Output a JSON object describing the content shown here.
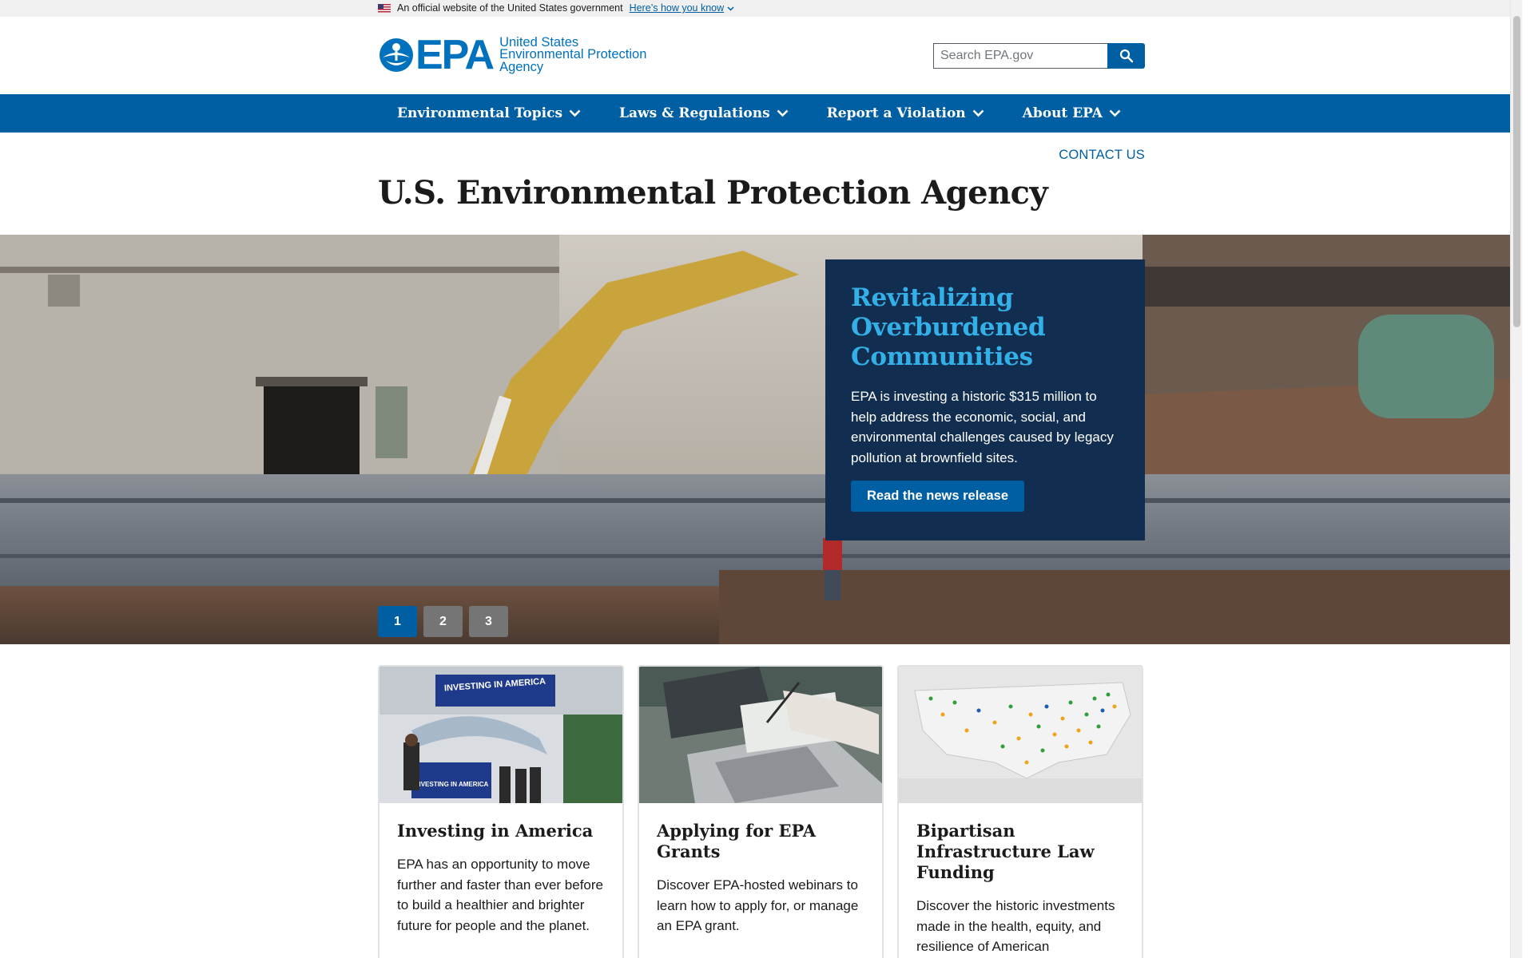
{
  "gov_banner": {
    "text": "An official website of the United States government",
    "link": "Here’s how you know"
  },
  "header": {
    "logo_text": "EPA",
    "agency_line1": "United States",
    "agency_line2": "Environmental Protection",
    "agency_line3": "Agency",
    "search_placeholder": "Search EPA.gov"
  },
  "nav": {
    "items": [
      {
        "label": "Environmental Topics"
      },
      {
        "label": "Laws & Regulations"
      },
      {
        "label": "Report a Violation"
      },
      {
        "label": "About EPA"
      }
    ]
  },
  "contact_label": "CONTACT US",
  "page_title": "U.S. Environmental Protection Agency",
  "hero": {
    "headline": "Revitalizing Overburdened Communities",
    "body": "EPA is investing a historic $315 million to help address the economic, social, and environmental challenges caused by legacy pollution at brownfield sites.",
    "button": "Read the news release",
    "slides": [
      "1",
      "2",
      "3"
    ],
    "active_slide": 1
  },
  "cards": [
    {
      "title": "Investing in America",
      "body": "EPA has an opportunity to move further and faster than ever before to build a healthier and brighter future for people and the planet.",
      "image_sign_top": "INVESTING IN AMERICA",
      "image_sign_bottom": "INVESTING IN AMERICA"
    },
    {
      "title": "Applying for EPA Grants",
      "body": "Discover EPA-hosted webinars to learn how to apply for, or manage an EPA grant."
    },
    {
      "title": "Bipartisan Infrastructure Law Funding",
      "body": "Discover the historic investments made in the health, equity, and resilience of American communities"
    }
  ],
  "colors": {
    "primary": "#005ea2",
    "hero_card_bg": "#112e51",
    "hero_headline": "#34b0e8"
  }
}
